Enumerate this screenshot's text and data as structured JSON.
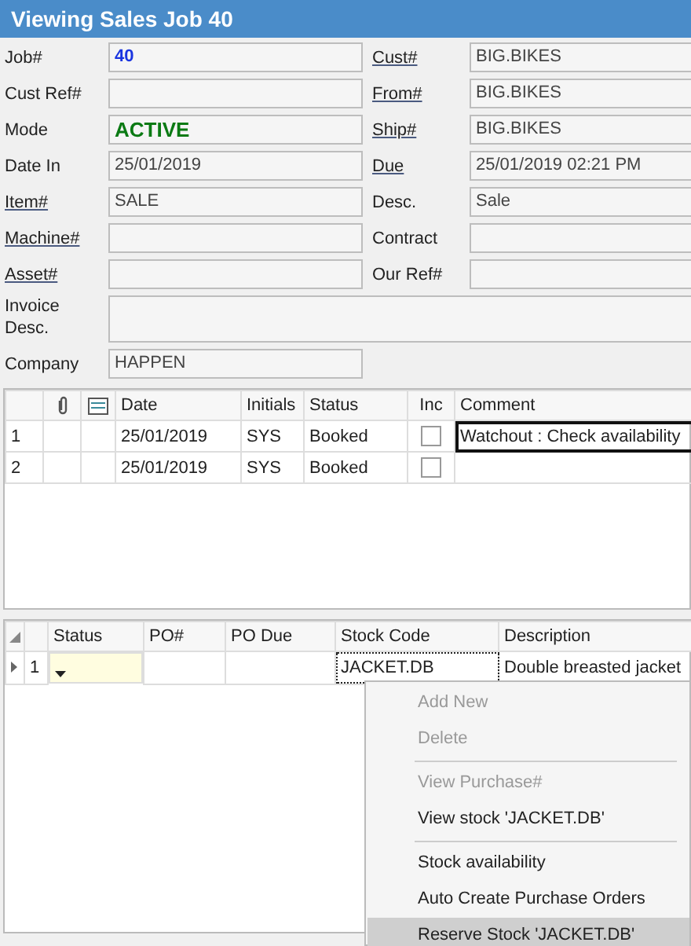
{
  "window": {
    "title": "Viewing Sales Job 40"
  },
  "form": {
    "rows": [
      {
        "left": {
          "label": "Job#",
          "value": "40",
          "kind": "number",
          "link": false
        },
        "right": {
          "label": "Cust#",
          "value": "BIG.BIKES",
          "kind": "text",
          "link": true
        }
      },
      {
        "left": {
          "label": "Cust Ref#",
          "link": false
        },
        "right": {
          "label": "From#",
          "value": "BIG.BIKES",
          "kind": "text",
          "link": true
        }
      },
      {
        "left": {
          "label": "Mode",
          "value": "ACTIVE",
          "kind": "status",
          "link": false
        },
        "right": {
          "label": "Ship#",
          "value": "BIG.BIKES",
          "kind": "text",
          "link": true
        }
      },
      {
        "left": {
          "label": "Date In",
          "value": "25/01/2019",
          "kind": "text",
          "link": false
        },
        "right": {
          "label": "Due",
          "value": "25/01/2019 02:21 PM",
          "kind": "text",
          "link": true
        }
      },
      {
        "left": {
          "label": "Item#",
          "value": "SALE",
          "kind": "text",
          "link": true
        },
        "right": {
          "label": "Desc.",
          "value": "Sale",
          "kind": "text",
          "link": false
        }
      },
      {
        "left": {
          "label": "Machine#",
          "link": true
        },
        "right": {
          "label": "Contract",
          "link": false
        }
      },
      {
        "left": {
          "label": "Asset#",
          "link": true
        },
        "right": {
          "label": "Our Ref#",
          "link": false
        }
      },
      {
        "wide": {
          "label": "Invoice Desc.",
          "link": false
        }
      },
      {
        "left": {
          "label": "Company",
          "value": "HAPPEN",
          "kind": "text",
          "link": false
        }
      }
    ]
  },
  "schedule": {
    "columns": [
      "Date",
      "Initials",
      "Status",
      "Inc",
      "Comment"
    ],
    "rows": [
      {
        "number": "1",
        "date": "25/01/2019",
        "initials": "SYS",
        "status": "Booked",
        "inc": false,
        "comment": "Watchout : Check availability",
        "focused": true
      },
      {
        "number": "2",
        "date": "25/01/2019",
        "initials": "SYS",
        "status": "Booked",
        "inc": false,
        "focused": false
      }
    ]
  },
  "lines": {
    "columns": [
      "Status",
      "PO#",
      "PO Due",
      "Stock Code",
      "Description"
    ],
    "rows": [
      {
        "number": "1",
        "current": true,
        "stock_code": "JACKET.DB",
        "description": "Double breasted jacket"
      }
    ]
  },
  "context_menu": {
    "items": [
      {
        "label": "Add New",
        "disabled": true,
        "selected": false,
        "divider_after": false
      },
      {
        "label": "Delete",
        "disabled": true,
        "selected": false,
        "divider_after": true
      },
      {
        "label": "View Purchase#",
        "disabled": true,
        "selected": false,
        "divider_after": false
      },
      {
        "label": "View stock 'JACKET.DB'",
        "disabled": false,
        "selected": false,
        "divider_after": true
      },
      {
        "label": "Stock availability",
        "disabled": false,
        "selected": false,
        "divider_after": false
      },
      {
        "label": "Auto Create Purchase Orders",
        "disabled": false,
        "selected": false,
        "divider_after": false
      },
      {
        "label": "Reserve Stock 'JACKET.DB'",
        "disabled": false,
        "selected": true,
        "divider_after": false
      }
    ]
  }
}
